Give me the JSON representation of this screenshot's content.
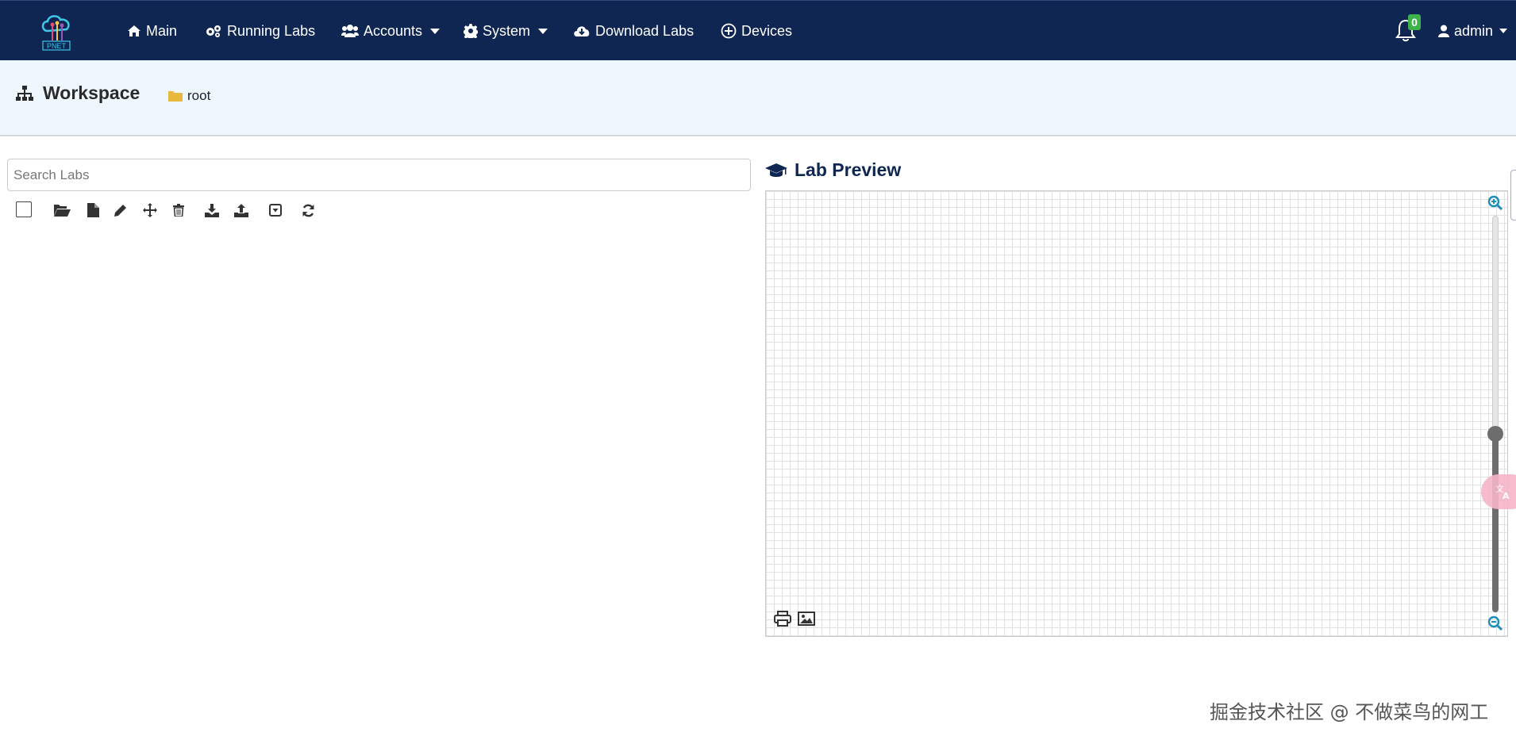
{
  "navbar": {
    "logo_text": "PNET",
    "items": [
      {
        "label": "Main",
        "icon": "home-icon"
      },
      {
        "label": "Running Labs",
        "icon": "cogs-icon"
      },
      {
        "label": "Accounts",
        "icon": "users-icon",
        "dropdown": true
      },
      {
        "label": "System",
        "icon": "gear-icon",
        "dropdown": true
      },
      {
        "label": "Download Labs",
        "icon": "cloud-download-icon"
      },
      {
        "label": "Devices",
        "icon": "plus-circle-icon"
      }
    ],
    "notifications_count": "0",
    "user_label": "admin"
  },
  "workspace": {
    "title": "Workspace",
    "path": "root"
  },
  "search": {
    "placeholder": "Search Labs",
    "value": ""
  },
  "toolbar": {
    "icons": [
      "select-all-checkbox",
      "open-folder-icon",
      "new-file-icon",
      "edit-icon",
      "move-icon",
      "delete-icon",
      "import-icon",
      "export-icon",
      "collapse-icon",
      "refresh-icon"
    ]
  },
  "preview": {
    "title": "Lab Preview",
    "zoom_level": 0.45
  },
  "watermark": "掘金技术社区 @ 不做菜鸟的网工",
  "colors": {
    "navbar_bg": "#0e2651",
    "header_bg": "#eff7fe",
    "badge": "#3cb34a",
    "accent": "#1b8fb5"
  }
}
